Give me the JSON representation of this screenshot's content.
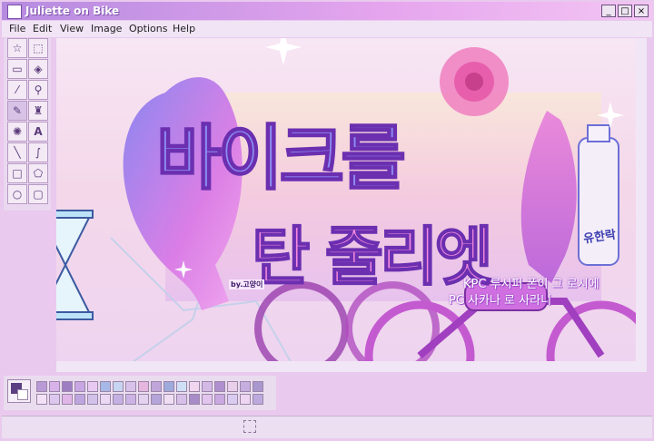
{
  "window": {
    "title": "Juliette on Bike",
    "minimize_label": "_",
    "maximize_label": "□",
    "close_label": "×"
  },
  "menu": {
    "items": [
      "File",
      "Edit",
      "View",
      "Image",
      "Options",
      "Help"
    ]
  },
  "toolbox": {
    "tools": [
      {
        "icon": "star-select-icon",
        "glyph": "☆"
      },
      {
        "icon": "rect-select-icon",
        "glyph": "⬚"
      },
      {
        "icon": "eraser-icon",
        "glyph": "▭"
      },
      {
        "icon": "fill-bucket-icon",
        "glyph": "◈"
      },
      {
        "icon": "eyedropper-icon",
        "glyph": "⁄"
      },
      {
        "icon": "magnifier-icon",
        "glyph": "⚲"
      },
      {
        "icon": "pencil-icon",
        "glyph": "✎"
      },
      {
        "icon": "brush-icon",
        "glyph": "♜"
      },
      {
        "icon": "airbrush-icon",
        "glyph": "✺"
      },
      {
        "icon": "text-icon",
        "glyph": "A"
      },
      {
        "icon": "line-icon",
        "glyph": "╲"
      },
      {
        "icon": "curve-icon",
        "glyph": "∫"
      },
      {
        "icon": "rectangle-icon",
        "glyph": "□"
      },
      {
        "icon": "polygon-icon",
        "glyph": "⬠"
      },
      {
        "icon": "ellipse-icon",
        "glyph": "○"
      },
      {
        "icon": "rounded-rect-icon",
        "glyph": "▢"
      }
    ]
  },
  "artwork": {
    "title_line1": "바이크를",
    "title_line2": "탄 줄리엣",
    "credit": "by.고양이",
    "caption_line1": "KPC 루시퍼 폰이 그 로시에",
    "caption_line2": "PC 사카나 로 사라니",
    "bottle_label": "유한락"
  },
  "palette": {
    "colors": [
      "#b99ad6",
      "#d8b2e9",
      "#9d7ec3",
      "#c8a6e3",
      "#e7c9f2",
      "#a6b9e6",
      "#c7d4f1",
      "#d7c3ea",
      "#e6b6de",
      "#bfa5d9",
      "#9ea9dc",
      "#cfe0f6",
      "#f1d6f0",
      "#d4b8e6",
      "#b08fce",
      "#e9cfe9",
      "#c6aee0",
      "#a997cf",
      "#f3e2f6",
      "#dcc7ee",
      "#e0b6e8",
      "#bda6df",
      "#d2c2ea",
      "#ead8f4",
      "#c4b0e2",
      "#cbb4e5",
      "#e4d2f1",
      "#b4a4da",
      "#f0def3",
      "#d6bfe8",
      "#a78cc8",
      "#e2c5ec",
      "#caa8e0",
      "#d9ccf0",
      "#eed6f2",
      "#bcaade"
    ],
    "selected_fg": "#5c3f82",
    "selected_bg": "#ffffff"
  },
  "colors": {
    "accent": "#b58be0",
    "title_stroke": "#6b2fb0",
    "magenta": "#d24fd6"
  }
}
